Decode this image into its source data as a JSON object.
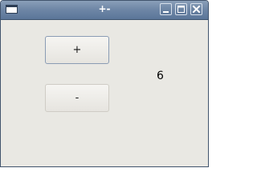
{
  "window": {
    "title": "+-",
    "controls": {
      "minimize_icon": "minimize-icon",
      "maximize_icon": "maximize-icon",
      "close_icon": "close-icon"
    }
  },
  "content": {
    "plus_label": "+",
    "minus_label": "-",
    "counter_value": "6"
  },
  "colors": {
    "titlebar": "#6f87a6",
    "window_background": "#e9e8e3",
    "focus_border": "#8a9cb4"
  }
}
